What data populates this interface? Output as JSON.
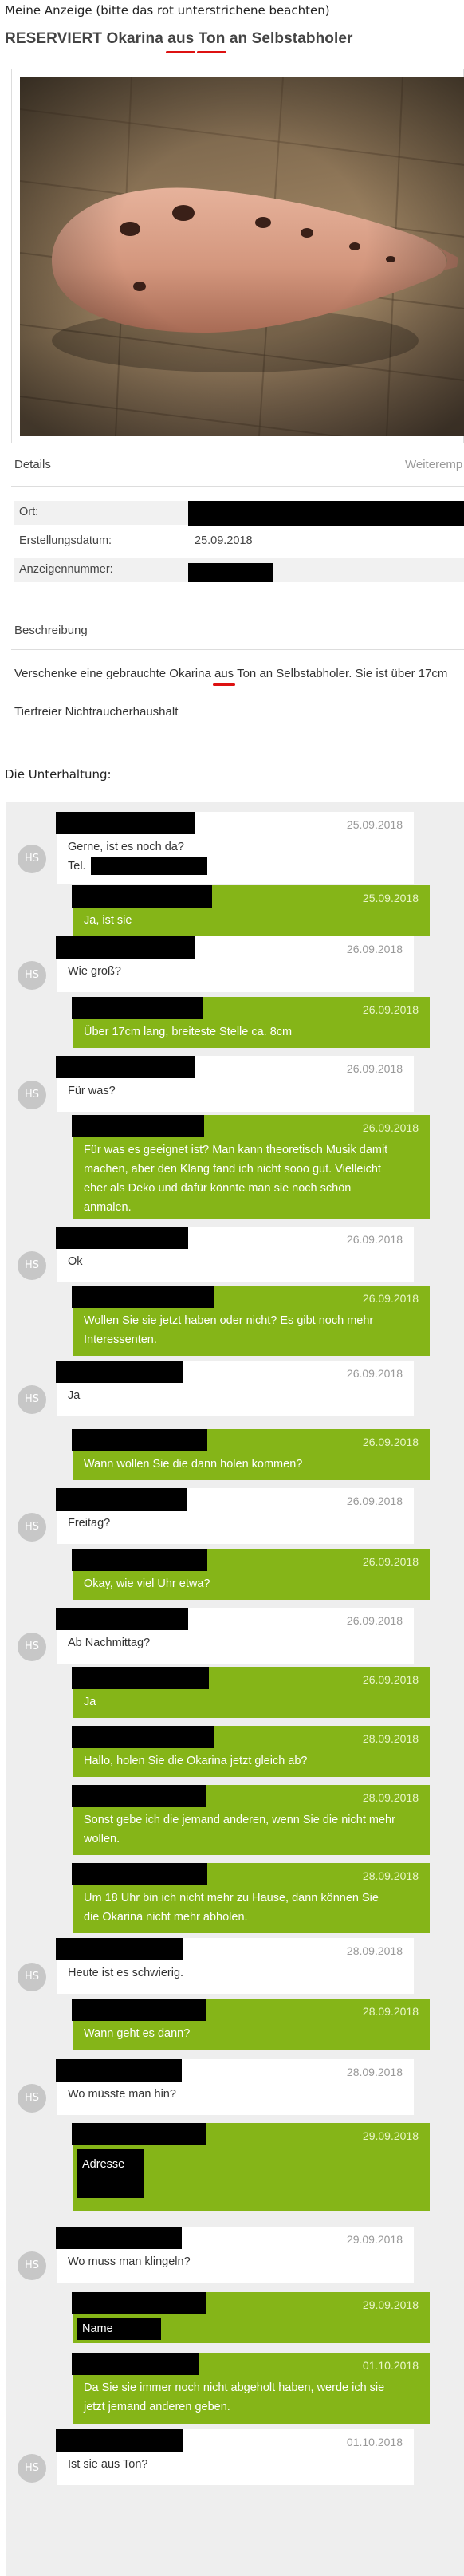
{
  "caption": "Meine Anzeige (bitte das rot unterstrichene beachten)",
  "listing": {
    "title_prefix": "RESERVIERT Okarina ",
    "title_aus": "aus",
    "title_ton": "Ton",
    "title_suffix": " an Selbstabholer",
    "details_label": "Details",
    "details_right": "Weiteremp",
    "ort_label": "Ort:",
    "date_label": "Erstellungsdatum:",
    "date_value": "25.09.2018",
    "number_label": "Anzeigennummer:",
    "beschreibung_label": "Beschreibung",
    "desc_prefix": "Verschenke eine gebrauchte Okarina ",
    "desc_aus": "aus",
    "desc_ton": "Ton",
    "desc_suffix": " an Selbstabholer. Sie ist über 17cm",
    "desc_line2": "Tierfreier Nichtraucherhaushalt"
  },
  "conversation_caption": "Die Unterhaltung:",
  "avatar_initials": "HS",
  "messages": [
    {
      "dir": "in",
      "date": "25.09.2018",
      "lines": [
        "Gerne, ist es noch da?",
        "Tel."
      ]
    },
    {
      "dir": "out",
      "date": "25.09.2018",
      "lines": [
        "Ja, ist sie"
      ]
    },
    {
      "dir": "in",
      "date": "26.09.2018",
      "lines": [
        "Wie groß?"
      ]
    },
    {
      "dir": "out",
      "date": "26.09.2018",
      "lines": [
        "Über 17cm lang, breiteste Stelle ca. 8cm"
      ]
    },
    {
      "dir": "in",
      "date": "26.09.2018",
      "lines": [
        "Für was?"
      ]
    },
    {
      "dir": "out",
      "date": "26.09.2018",
      "lines": [
        "Für was es geeignet ist? Man kann theoretisch Musik damit",
        "machen, aber den Klang fand ich nicht sooo gut. Vielleicht",
        "eher als Deko und dafür könnte man sie noch schön",
        "anmalen."
      ]
    },
    {
      "dir": "in",
      "date": "26.09.2018",
      "lines": [
        "Ok"
      ]
    },
    {
      "dir": "out",
      "date": "26.09.2018",
      "lines": [
        "Wollen Sie sie jetzt haben oder nicht? Es gibt noch mehr",
        "Interessenten."
      ]
    },
    {
      "dir": "in",
      "date": "26.09.2018",
      "lines": [
        "Ja"
      ]
    },
    {
      "dir": "out",
      "date": "26.09.2018",
      "lines": [
        "Wann wollen Sie die dann holen kommen?"
      ]
    },
    {
      "dir": "in",
      "date": "26.09.2018",
      "lines": [
        "Freitag?"
      ]
    },
    {
      "dir": "out",
      "date": "26.09.2018",
      "lines": [
        "Okay, wie viel Uhr etwa?"
      ]
    },
    {
      "dir": "in",
      "date": "26.09.2018",
      "lines": [
        "Ab Nachmittag?"
      ]
    },
    {
      "dir": "out",
      "date": "26.09.2018",
      "lines": [
        "Ja"
      ]
    },
    {
      "dir": "out",
      "date": "28.09.2018",
      "lines": [
        "Hallo, holen Sie die Okarina jetzt gleich ab?"
      ]
    },
    {
      "dir": "out",
      "date": "28.09.2018",
      "lines": [
        "Sonst gebe ich die jemand anderen, wenn Sie die nicht mehr",
        "wollen."
      ]
    },
    {
      "dir": "out",
      "date": "28.09.2018",
      "lines": [
        "Um 18 Uhr bin ich nicht mehr zu Hause, dann können Sie",
        "die Okarina nicht mehr abholen."
      ]
    },
    {
      "dir": "in",
      "date": "28.09.2018",
      "lines": [
        "Heute ist es schwierig."
      ]
    },
    {
      "dir": "out",
      "date": "28.09.2018",
      "lines": [
        "Wann geht es dann?"
      ]
    },
    {
      "dir": "in",
      "date": "28.09.2018",
      "lines": [
        "Wo müsste man hin?"
      ]
    },
    {
      "dir": "out",
      "date": "29.09.2018",
      "lines": [
        "Adresse"
      ]
    },
    {
      "dir": "in",
      "date": "29.09.2018",
      "lines": [
        "Wo muss man klingeln?"
      ]
    },
    {
      "dir": "out",
      "date": "29.09.2018",
      "lines": [
        "Name"
      ]
    },
    {
      "dir": "out",
      "date": "01.10.2018",
      "lines": [
        "Da Sie sie immer noch nicht abgeholt haben, werde ich sie",
        "jetzt jemand anderen geben."
      ]
    },
    {
      "dir": "in",
      "date": "01.10.2018",
      "lines": [
        "Ist sie aus Ton?"
      ]
    }
  ]
}
